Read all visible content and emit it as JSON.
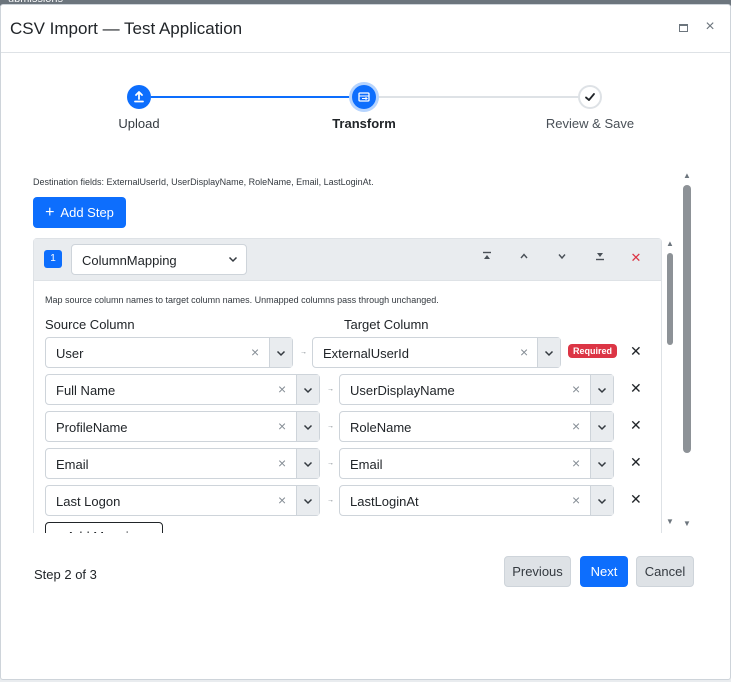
{
  "background": {
    "partial_text": "ubmissions"
  },
  "window": {
    "title": "CSV Import — Test Application",
    "maximize_icon": "maximize-icon",
    "close_icon": "close-icon"
  },
  "stepper": {
    "steps": [
      {
        "label": "Upload",
        "icon": "upload-icon",
        "state": "complete"
      },
      {
        "label": "Transform",
        "icon": "transform-icon",
        "state": "active"
      },
      {
        "label": "Review & Save",
        "icon": "check-icon",
        "state": "pending"
      }
    ]
  },
  "destination_fields_text": "Destination fields: ExternalUserId, UserDisplayName, RoleName, Email, LastLoginAt.",
  "add_step_label": "Add Step",
  "step_card": {
    "number": "1",
    "type": "ColumnMapping",
    "hint": "Map source column names to target column names. Unmapped columns pass through unchanged.",
    "source_header": "Source Column",
    "target_header": "Target Column",
    "required_label": "Required",
    "mappings": [
      {
        "source": "User",
        "target": "ExternalUserId",
        "required": true
      },
      {
        "source": "Full Name",
        "target": "UserDisplayName",
        "required": false
      },
      {
        "source": "ProfileName",
        "target": "RoleName",
        "required": false
      },
      {
        "source": "Email",
        "target": "Email",
        "required": false
      },
      {
        "source": "Last Logon",
        "target": "LastLoginAt",
        "required": false
      }
    ],
    "add_mapping_label": "+ Add Mapping"
  },
  "footer": {
    "step_indicator": "Step 2 of 3",
    "previous_label": "Previous",
    "next_label": "Next",
    "cancel_label": "Cancel"
  },
  "colors": {
    "primary": "#0d6efd",
    "danger": "#dc3545",
    "secondary_bg": "#dee2e6"
  }
}
